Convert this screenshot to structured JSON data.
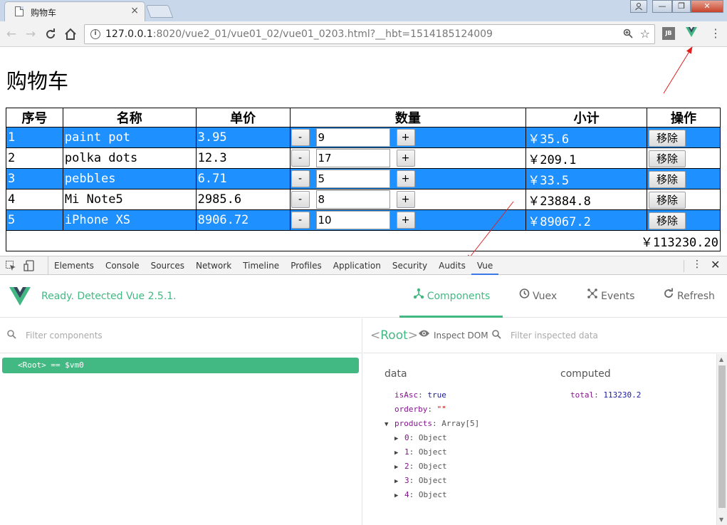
{
  "browser": {
    "tab_title": "购物车",
    "tab_close": "×",
    "url_host": "127.0.0.1",
    "url_rest": ":8020/vue2_01/vue01_02/vue01_0203.html?__hbt=1514185124009",
    "win_min": "—",
    "win_max": "❐",
    "win_close": "✕",
    "ext_jb": "JB"
  },
  "page": {
    "title": "购物车",
    "headers": [
      "序号",
      "名称",
      "单价",
      "数量",
      "小计",
      "操作"
    ],
    "rows": [
      {
        "no": "1",
        "name": "paint pot",
        "price": "3.95",
        "qty": "9",
        "subtotal": "￥35.6",
        "highlight": true
      },
      {
        "no": "2",
        "name": "polka dots",
        "price": "12.3",
        "qty": "17",
        "subtotal": "￥209.1",
        "highlight": false
      },
      {
        "no": "3",
        "name": "pebbles",
        "price": "6.71",
        "qty": "5",
        "subtotal": "￥33.5",
        "highlight": true
      },
      {
        "no": "4",
        "name": "Mi Note5",
        "price": "2985.6",
        "qty": "8",
        "subtotal": "￥23884.8",
        "highlight": false
      },
      {
        "no": "5",
        "name": "iPhone XS",
        "price": "8906.72",
        "qty": "10",
        "subtotal": "￥89067.2",
        "highlight": true
      }
    ],
    "minus_label": "-",
    "plus_label": "+",
    "remove_label": "移除",
    "total": "￥113230.20",
    "highlight_color": "#1e90ff"
  },
  "devtools": {
    "tabs": [
      "Elements",
      "Console",
      "Sources",
      "Network",
      "Timeline",
      "Profiles",
      "Application",
      "Security",
      "Audits",
      "Vue"
    ],
    "active_tab": "Vue"
  },
  "vue": {
    "status": "Ready. Detected Vue 2.5.1.",
    "nav": {
      "components": "Components",
      "vuex": "Vuex",
      "events": "Events",
      "refresh": "Refresh"
    },
    "filter_placeholder": "Filter components",
    "root_row": "<Root> == $vm0",
    "root_label": "Root",
    "inspect_dom": "Inspect DOM",
    "filter_inspected": "Filter inspected data",
    "data_title": "data",
    "computed_title": "computed",
    "data_props": [
      {
        "key": "isAsc",
        "value": "true",
        "kind": "v",
        "tri": ""
      },
      {
        "key": "orderby",
        "value": "\"\"",
        "kind": "str",
        "tri": ""
      },
      {
        "key": "products",
        "value": "Array[5]",
        "kind": "plain",
        "tri": "▼"
      }
    ],
    "product_items": [
      "0",
      "1",
      "2",
      "3",
      "4"
    ],
    "object_label": "Object",
    "computed_props": [
      {
        "key": "total",
        "value": "113230.2"
      }
    ],
    "accent": "#42b983"
  }
}
